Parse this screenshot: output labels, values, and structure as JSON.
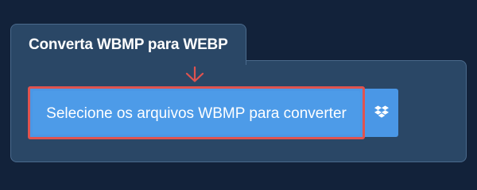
{
  "tab": {
    "title": "Converta WBMP para WEBP"
  },
  "uploader": {
    "select_label": "Selecione os arquivos WBMP para converter",
    "dropbox_icon": "dropbox-icon",
    "arrow_icon": "arrow-down-icon"
  },
  "colors": {
    "page_background": "#12223a",
    "panel": "#2a4766",
    "button": "#4a97e6",
    "highlight": "#e0534f"
  }
}
